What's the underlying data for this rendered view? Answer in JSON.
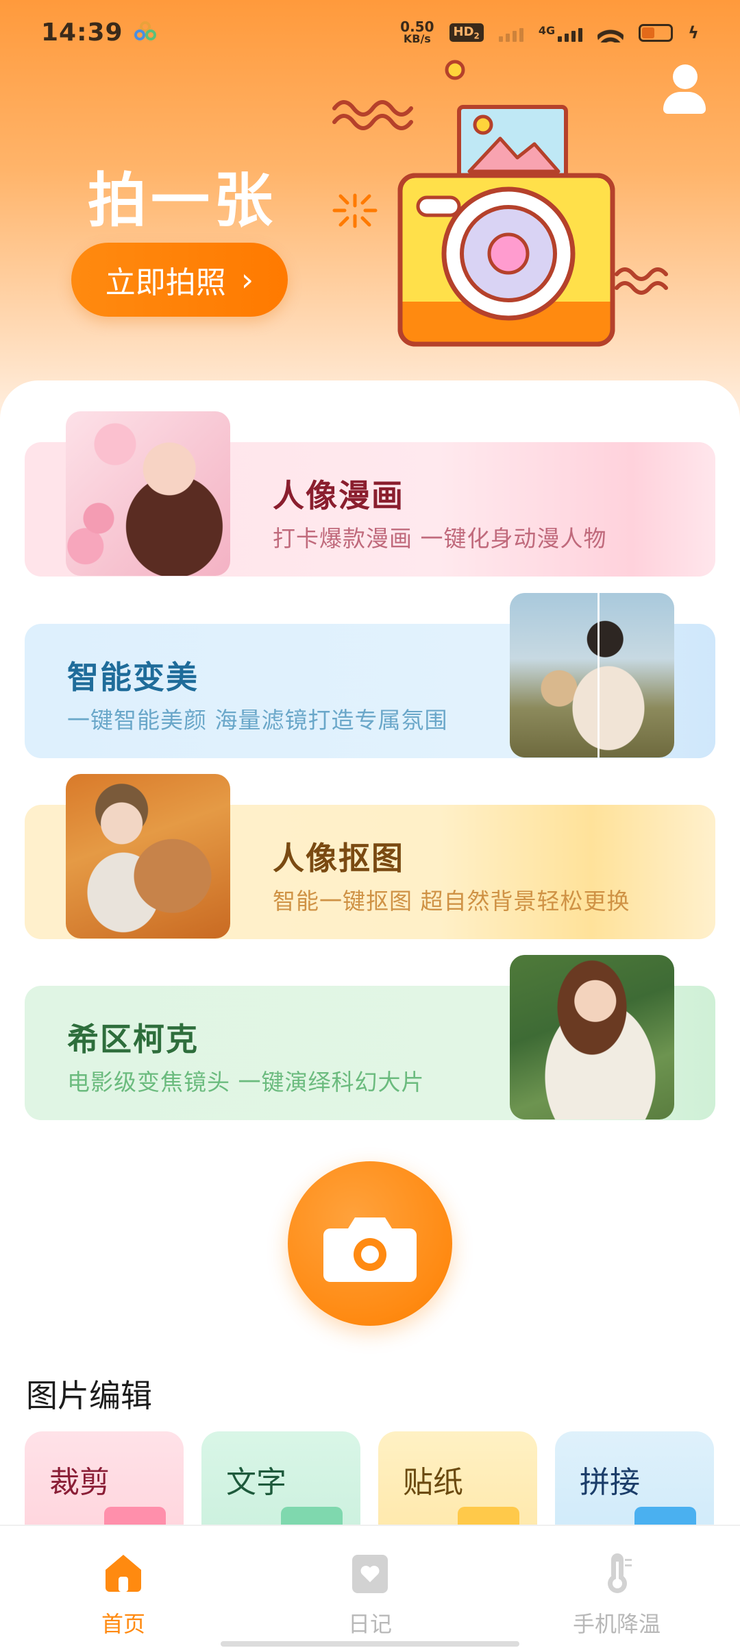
{
  "status_bar": {
    "time": "14:39",
    "net_speed_value": "0.50",
    "net_speed_unit": "KB/s",
    "hd_badge": "HD",
    "hd_sub": "2",
    "network_type": "4G",
    "battery_level": 0.4
  },
  "hero": {
    "title": "拍一张",
    "shoot_button_label": "立即拍照",
    "shoot_button_chevron": "›"
  },
  "features": [
    {
      "title": "人像漫画",
      "desc": "打卡爆款漫画  一键化身动漫人物"
    },
    {
      "title": "智能变美",
      "desc": "一键智能美颜 海量滤镜打造专属氛围"
    },
    {
      "title": "人像抠图",
      "desc": "智能一键抠图 超自然背景轻松更换"
    },
    {
      "title": "希区柯克",
      "desc": "电影级变焦镜头  一键演绎科幻大片"
    }
  ],
  "photo_edit": {
    "section_title": "图片编辑",
    "tools": [
      {
        "label": "裁剪"
      },
      {
        "label": "文字"
      },
      {
        "label": "贴纸"
      },
      {
        "label": "拼接"
      }
    ]
  },
  "bottom_nav": {
    "items": [
      {
        "label": "首页",
        "icon": "home-icon",
        "active": true
      },
      {
        "label": "日记",
        "icon": "diary-heart-icon",
        "active": false
      },
      {
        "label": "手机降温",
        "icon": "thermometer-icon",
        "active": false
      }
    ]
  },
  "colors": {
    "accent": "#ff8a10",
    "comic_title": "#8a1e2e",
    "beauty_title": "#1f6c9a",
    "cutout_title": "#7a4a12",
    "hitchcock_title": "#2e6e3c"
  }
}
